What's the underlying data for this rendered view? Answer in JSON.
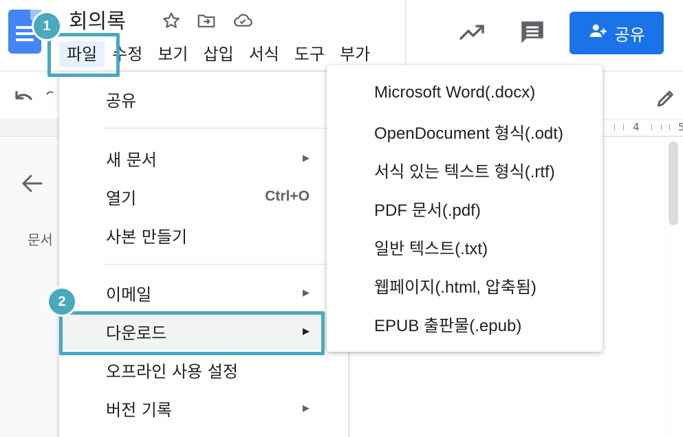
{
  "doc": {
    "title": "회의록"
  },
  "menubar": {
    "items": [
      "파일",
      "수정",
      "보기",
      "삽입",
      "서식",
      "도구",
      "부가"
    ]
  },
  "header": {
    "share_label": "공유"
  },
  "ruler": {
    "numbers": [
      "4",
      "5"
    ]
  },
  "outline": {
    "label": "문서"
  },
  "file_menu": {
    "share": "공유",
    "new_doc": "새 문서",
    "open": "열기",
    "open_shortcut": "Ctrl+O",
    "copy": "사본 만들기",
    "email": "이메일",
    "download": "다운로드",
    "offline": "오프라인 사용 설정",
    "version": "버전 기록",
    "submenu_arrow": "▶"
  },
  "download_menu": {
    "items": [
      "Microsoft Word(.docx)",
      "OpenDocument 형식(.odt)",
      "서식 있는 텍스트 형식(.rtf)",
      "PDF 문서(.pdf)",
      "일반 텍스트(.txt)",
      "웹페이지(.html, 압축됨)",
      "EPUB 출판물(.epub)"
    ]
  },
  "callouts": {
    "step1": "1",
    "step2": "2",
    "color": "#4aa8c0"
  },
  "colors": {
    "brand_blue": "#1a73e8",
    "docs_blue": "#4285f4"
  },
  "icons": {
    "star": "star-icon",
    "move": "move-to-folder-icon",
    "cloud": "cloud-saved-icon",
    "trend": "trending-up-icon",
    "comment": "comment-icon",
    "share": "people-icon",
    "undo": "undo-icon",
    "redo": "redo-icon",
    "edit": "pencil-icon",
    "back": "arrow-back-icon"
  }
}
